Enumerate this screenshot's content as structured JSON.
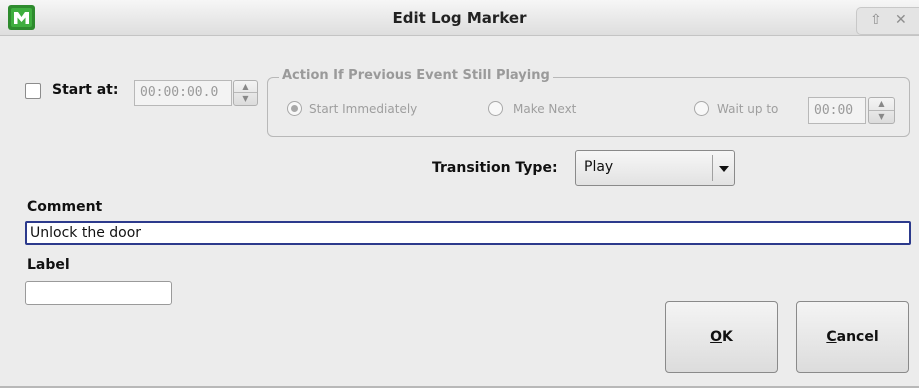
{
  "window": {
    "title": "Edit Log Marker",
    "controls": {
      "shade_glyph": "⇧",
      "close_glyph": "✕"
    }
  },
  "start_at": {
    "label": "Start at:",
    "checked": false,
    "time_value": "00:00:00.0"
  },
  "action_group": {
    "title": "Action If Previous Event Still Playing",
    "options": [
      {
        "label": "Start Immediately",
        "selected": true
      },
      {
        "label": "Make Next",
        "selected": false
      },
      {
        "label": "Wait up to",
        "selected": false
      }
    ],
    "wait_value": "00:00"
  },
  "transition": {
    "label": "Transition Type:",
    "value": "Play"
  },
  "comment": {
    "label": "Comment",
    "value": "Unlock the door"
  },
  "label_field": {
    "label": "Label",
    "value": ""
  },
  "buttons": {
    "ok": {
      "accel": "O",
      "rest": "K"
    },
    "cancel": {
      "accel": "C",
      "rest": "ancel"
    }
  },
  "colors": {
    "focus_border": "#2c3a8c",
    "app_icon_green": "#2e8b2e",
    "disabled_text": "#9e9e9e"
  },
  "icons": [
    "app-logo-icon",
    "shade-icon",
    "close-icon",
    "spin-up-icon",
    "spin-down-icon",
    "dropdown-arrow-icon"
  ]
}
